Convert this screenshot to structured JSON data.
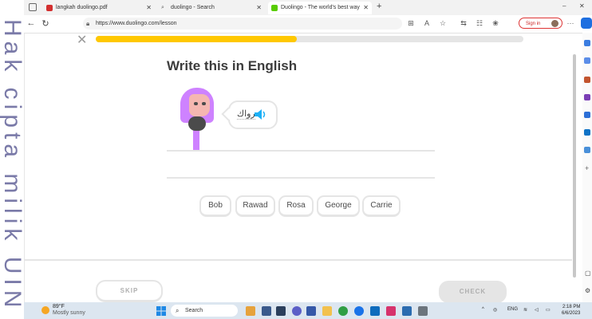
{
  "watermark": "Hak cipta milik UIN",
  "browser": {
    "tabs": [
      {
        "title": "langkah duolingo.pdf",
        "icon": "pdf-icon",
        "color": "#d32f2f"
      },
      {
        "title": "duolingo - Search",
        "icon": "search-icon",
        "color": "#555555"
      },
      {
        "title": "Duolingo - The world's best way",
        "icon": "duolingo-icon",
        "color": "#58cc02"
      }
    ],
    "new_tab": "+",
    "url": "https://www.duolingo.com/lesson",
    "sign_in": "Sign in",
    "menu": "···"
  },
  "lesson": {
    "close": "✕",
    "progress": 0.47,
    "title": "Write this in English",
    "prompt_word": "رواك",
    "word_bank": [
      "Bob",
      "Rawad",
      "Rosa",
      "George",
      "Carrie"
    ],
    "skip": "SKIP",
    "check": "CHECK"
  },
  "colors": {
    "progress": "#ffc800",
    "character": "#ce82ff",
    "speaker": "#1cb0f6"
  },
  "taskbar": {
    "temp": "89°F",
    "weather": "Mostly sunny",
    "search": "Search",
    "tray_lang": "ENG",
    "time": "2:18 PM",
    "date": "6/6/2023"
  }
}
